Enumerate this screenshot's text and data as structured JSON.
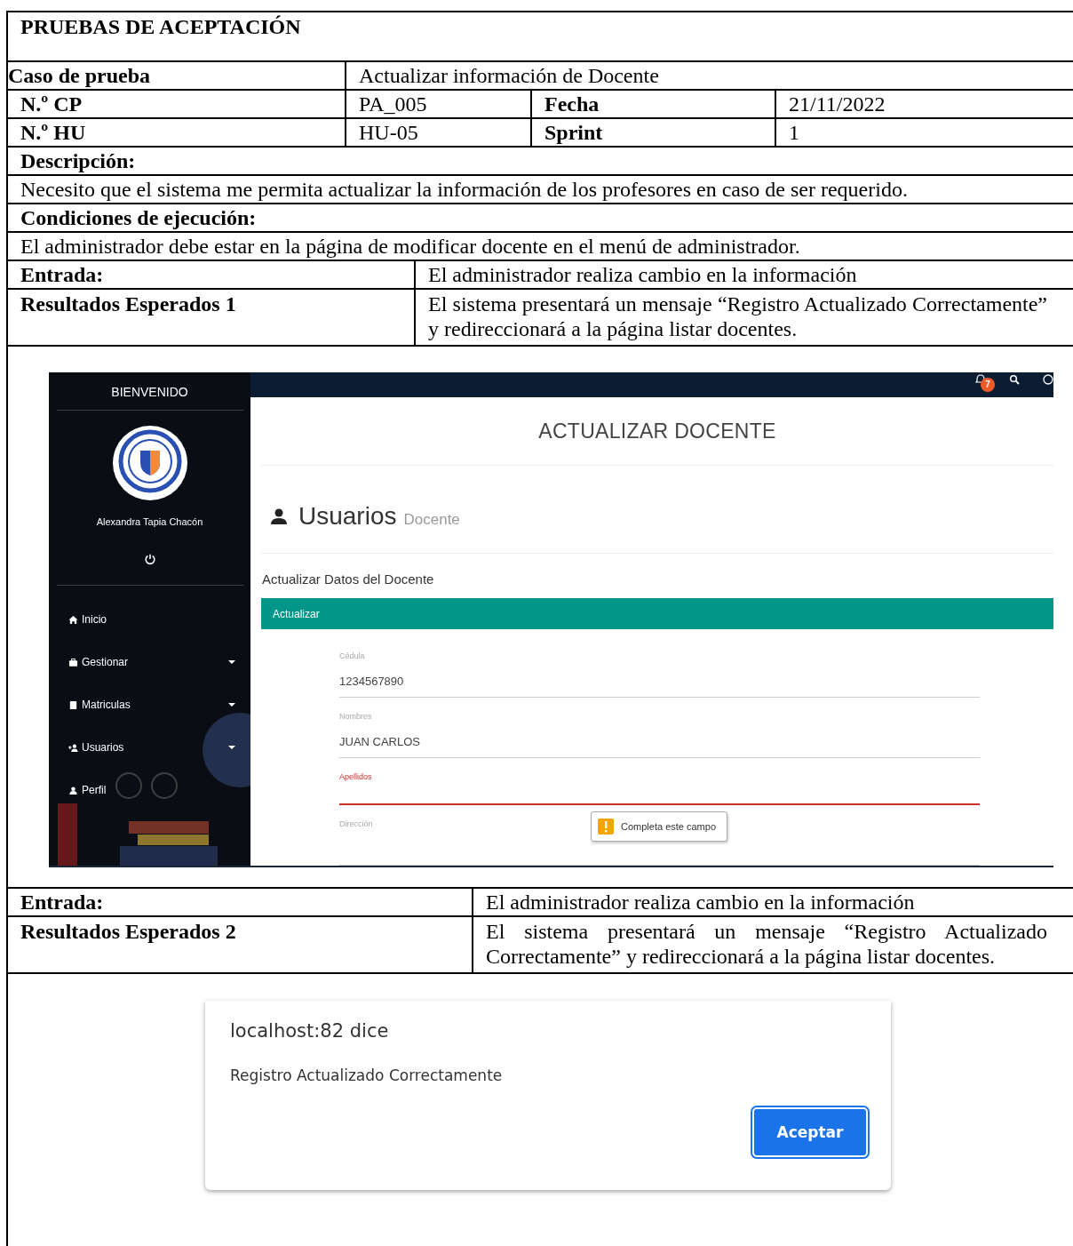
{
  "table": {
    "title": "PRUEBAS DE ACEPTACIÓN",
    "test_case": {
      "label": "Caso de prueba",
      "value": "Actualizar información de Docente"
    },
    "info_rows": [
      {
        "label": "N.º CP",
        "value": "PA_005",
        "label_2": "Fecha",
        "value_2": "21/11/2022"
      },
      {
        "label": "N.º HU",
        "value": "HU-05",
        "label_2": "Sprint",
        "value_2": "1"
      }
    ],
    "sections": [
      {
        "label": "Descripción:",
        "text": "Necesito que el sistema me permita actualizar la información de los profesores en caso de ser requerido."
      },
      {
        "label": "Condiciones de ejecución:",
        "text": "El administrador debe estar en la página de modificar docente en el menú de administrador."
      }
    ],
    "steps": [
      {
        "input_label": "Entrada:",
        "input": "El administrador realiza cambio en la información",
        "result_label": "Resultados Esperados 1",
        "result": "El sistema presentará un mensaje “Registro Actualizado Correctamente” y redireccionará a la página listar docentes.",
        "evidence": {
          "kind": "app",
          "sidebar": {
            "welcome": "BIENVENIDO",
            "user": "Alexandra Tapia Chacón",
            "menu": [
              {
                "label": "Inicio",
                "has_submenu": false
              },
              {
                "label": "Gestionar",
                "has_submenu": true
              },
              {
                "label": "Matriculas",
                "has_submenu": true
              },
              {
                "label": "Usuarios",
                "has_submenu": true
              },
              {
                "label": "Perfil",
                "has_submenu": false
              }
            ]
          },
          "topbar": {
            "notification_count": "7"
          },
          "page_title": "ACTUALIZAR DOCENTE",
          "header": {
            "title": "Usuarios",
            "subtitle": "Docente"
          },
          "form_title": "Actualizar Datos del Docente",
          "panel_title": "Actualizar",
          "fields": [
            {
              "label": "Cédula",
              "value": "1234567890",
              "invalid": false
            },
            {
              "label": "Nombres",
              "value": "JUAN CARLOS",
              "invalid": false
            },
            {
              "label": "Apellidos",
              "invalid": true,
              "tooltip": "Completa este campo"
            },
            {
              "label": "Dirección",
              "invalid": false
            }
          ]
        }
      },
      {
        "input_label": "Entrada:",
        "input": "El administrador realiza cambio en la información",
        "result_label": "Resultados Esperados 2",
        "result": "El sistema presentará un mensaje “Registro Actualizado Correctamente” y redireccionará a la página listar docentes.",
        "evidence": {
          "kind": "dialog",
          "origin": "localhost:82 dice",
          "message": "Registro Actualizado Correctamente",
          "button": "Aceptar"
        }
      }
    ]
  }
}
